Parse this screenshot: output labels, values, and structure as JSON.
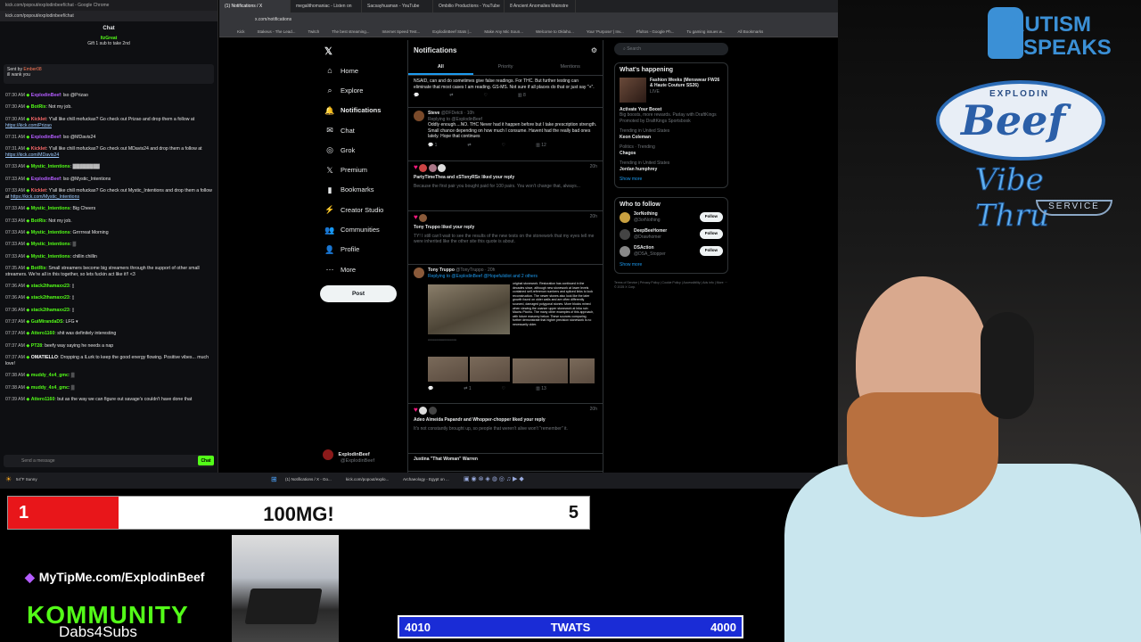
{
  "chat_window": {
    "title": "kick.com/popout/explodinbeef/chat - Google Chrome",
    "url": "kick.com/popout/explodinbeef/chat",
    "header": "Chat",
    "pinned_user": "ItzGreat",
    "pinned_text": "Gift 1 sub to take 2nd",
    "sent_by_label": "Sent by",
    "sent_by_user": "Ember08",
    "sent_text": "ill wank you",
    "input_placeholder": "Send a message",
    "chat_button": "Chat",
    "messages": [
      {
        "time": "07:30 AM",
        "user": "ExplodinBeef",
        "user_color": "#b45cff",
        "text": "lso @Prizao"
      },
      {
        "time": "07:30 AM",
        "user": "BotRix",
        "user_color": "#53fc18",
        "text": "Not my job."
      },
      {
        "time": "07:30 AM",
        "user": "Kicklet",
        "user_color": "#ff6b6b",
        "text": "Y'all like chill mofuckas? Go check out Prizao and drop them a follow at ",
        "link": "https://kick.com/Prizao"
      },
      {
        "time": "07:31 AM",
        "user": "ExplodinBeef",
        "user_color": "#b45cff",
        "text": "lso @MDavis24"
      },
      {
        "time": "07:31 AM",
        "user": "Kicklet",
        "user_color": "#ff6b6b",
        "text": "Y'all like chill mofuckas? Go check out MDavis24 and drop them a follow at ",
        "link": "https://kick.com/MDavis24"
      },
      {
        "time": "07:33 AM",
        "user": "Mystic_Intentions",
        "user_color": "#53fc18",
        "text": "▓▓▓▓▓▓▓▓"
      },
      {
        "time": "07:33 AM",
        "user": "ExplodinBeef",
        "user_color": "#b45cff",
        "text": "lso @Mystic_Intentions"
      },
      {
        "time": "07:33 AM",
        "user": "Kicklet",
        "user_color": "#ff6b6b",
        "text": "Y'all like chill mofuckas? Go check out Mystic_Intentions and drop them a follow at ",
        "link": "https://kick.com/Mystic_Intentions"
      },
      {
        "time": "07:33 AM",
        "user": "Mystic_Intentions",
        "user_color": "#53fc18",
        "text": "Big Cheers"
      },
      {
        "time": "07:33 AM",
        "user": "BotRix",
        "user_color": "#53fc18",
        "text": "Not my job."
      },
      {
        "time": "07:33 AM",
        "user": "Mystic_Intentions",
        "user_color": "#53fc18",
        "text": "Grrrrreat Morning"
      },
      {
        "time": "07:33 AM",
        "user": "Mystic_Intentions",
        "user_color": "#53fc18",
        "text": "▒"
      },
      {
        "time": "07:33 AM",
        "user": "Mystic_Intentions",
        "user_color": "#53fc18",
        "text": "chillin chillin"
      },
      {
        "time": "07:35 AM",
        "user": "BotRix",
        "user_color": "#53fc18",
        "text": "Small streamers become big streamers through the support of other small streamers. We're all in this together, so lets fuckin act like it!! <3"
      },
      {
        "time": "07:36 AM",
        "user": "stack2thamaxx23",
        "user_color": "#53fc18",
        "text": "▯"
      },
      {
        "time": "07:36 AM",
        "user": "stack2thamaxx23",
        "user_color": "#53fc18",
        "text": "▯"
      },
      {
        "time": "07:36 AM",
        "user": "stack2thamaxx23",
        "user_color": "#53fc18",
        "text": "▯"
      },
      {
        "time": "07:37 AM",
        "user": "GuiMirandaDS",
        "user_color": "#53fc18",
        "text": "LFG ▾"
      },
      {
        "time": "07:37 AM",
        "user": "Attero1160",
        "user_color": "#53fc18",
        "text": "shit was definitely interesting"
      },
      {
        "time": "07:37 AM",
        "user": "PT28",
        "user_color": "#53fc18",
        "text": "beefy way saying he needs a nap"
      },
      {
        "time": "07:37 AM",
        "user": "OMATIELLO",
        "user_color": "#ffffff",
        "text": "Dropping a lLurk to keep the good energy flowing. Positive vibes... much love!"
      },
      {
        "time": "07:38 AM",
        "user": "muddy_4x4_gmc",
        "user_color": "#53fc18",
        "text": "▒"
      },
      {
        "time": "07:38 AM",
        "user": "muddy_4x4_gmc",
        "user_color": "#53fc18",
        "text": "▒"
      },
      {
        "time": "07:39 AM",
        "user": "Attero1160",
        "user_color": "#53fc18",
        "text": "but as the way we can figure out savage's couldn't have done that"
      }
    ]
  },
  "browser": {
    "tabs": [
      "(1) Notifications / X",
      "megalithomaniac - Listen on",
      "Sacsayhuaman - YouTube",
      "Ombilio Productions - YouTube",
      "8 Ancient Anomalies Mainstre"
    ],
    "url": "x.com/notifications",
    "bookmarks": [
      "Kick",
      "Stakeus - The Lead...",
      "Twitch",
      "The best streaming...",
      "Internet Speed Test...",
      "ExplodinBeef Stats |...",
      "Make Any Mic Soun...",
      "Welcome to Oklaho...",
      "Your 'Purpose' | Inv...",
      "Ffultos - Google Ph...",
      "Tu gaming issues w...",
      "All Bookmarks"
    ]
  },
  "x_nav": {
    "items": [
      {
        "icon": "home-icon",
        "glyph": "⌂",
        "label": "Home"
      },
      {
        "icon": "search-icon",
        "glyph": "⌕",
        "label": "Explore"
      },
      {
        "icon": "bell-icon",
        "glyph": "🔔",
        "label": "Notifications"
      },
      {
        "icon": "chat-icon",
        "glyph": "✉",
        "label": "Chat"
      },
      {
        "icon": "grok-icon",
        "glyph": "◎",
        "label": "Grok"
      },
      {
        "icon": "x-icon",
        "glyph": "𝕏",
        "label": "Premium"
      },
      {
        "icon": "bookmark-icon",
        "glyph": "▮",
        "label": "Bookmarks"
      },
      {
        "icon": "bolt-icon",
        "glyph": "⚡",
        "label": "Creator Studio"
      },
      {
        "icon": "people-icon",
        "glyph": "👥",
        "label": "Communities"
      },
      {
        "icon": "person-icon",
        "glyph": "👤",
        "label": "Profile"
      },
      {
        "icon": "more-icon",
        "glyph": "⋯",
        "label": "More"
      }
    ],
    "post_button": "Post",
    "profile_name": "ExplodinBeef",
    "profile_handle": "@ExplodinBeef"
  },
  "notifications": {
    "title": "Notifications",
    "tabs": [
      "All",
      "Priority",
      "Mentions"
    ],
    "items": [
      {
        "text": "NSAID, can and do sometimes give false readings. For THC. But further testing can eliminate that most cases I am reading. GS-MS. Not sure if all places do that or just say \"+\".",
        "replies": "",
        "reposts": "",
        "likes": "",
        "views": "8"
      },
      {
        "name": "Steve",
        "handle": "@DFDetcti · 10h",
        "reply_to": "Replying to @ExplodinBeef",
        "text": "Oddly enough....NO. THC Never had it happen before but I take prescription strength. Small chance depending on how much I consume. Havent had the really bad ones lately. Hope that continues",
        "replies": "1",
        "likes": "",
        "views": "12"
      },
      {
        "like_text": "PartyTimeThea and xSTonyRSx liked your reply",
        "time": "20h",
        "quote": "Because the first pair you bought paid for 100 pairs. You won't change that, always..."
      },
      {
        "like_text": "Tony Truppo liked your reply",
        "time": "20h",
        "quote": "TY! I still can't wait to see the results of the new tests on the stonework that my eyes tell me were inherited like the other site this quote is about."
      },
      {
        "name": "Tony Truppo",
        "handle": "@TonyTruppo · 20h",
        "reply_to": "Replying to @ExplodinBeef @Hopefulidiot and 2 others",
        "side_text": "original stonework. Restoration has continued in the decades since, although new stonework at lower levels contained self-reference numbers and spliced links to look reconstruction. The newer stones also look like the later growth found on older walls and are often differently sourced, damaged polygonal stones. More blocks mined when viewing the coarser upper stonework at Inka ruin Machu Picchu. The many other examples of this approach, with future masonry below. These sources comparing further demonstrate that higher precision stonework is no necessarily older.",
        "replies": "1",
        "views": "13"
      },
      {
        "like_text": "Adeo Almeida Papandr and Whopper-chopper liked your reply",
        "time": "20h",
        "quote": "It's not constantly brought up, so people that weren't alive won't \"remember\" it."
      },
      {
        "like_text": "Justina \"That Woman\" Warren",
        "time": "",
        "quote": ""
      }
    ]
  },
  "right_col": {
    "search_placeholder": "Search",
    "happening_title": "What's happening",
    "trend1": "Fashion Weeks (Menswear FW26 & Haute Couture SS26)",
    "trend1_meta": "LIVE",
    "promo_title": "Activate Your Boost",
    "promo_text": "Big boosts, more rewards. Parlay with DraftKings",
    "promo_by": "Promoted by DraftKings Sportsbook",
    "trends": [
      {
        "meta": "Trending in United States",
        "name": "Keon Coleman"
      },
      {
        "meta": "Politics · Trending",
        "name": "Chagos"
      },
      {
        "meta": "Trending in United States",
        "name": "Jordan humphrey"
      }
    ],
    "show_more": "Show more",
    "who_title": "Who to follow",
    "follow": [
      {
        "name": "3orNothing",
        "handle": "@3orNothing"
      },
      {
        "name": "DeepBeeHomer",
        "handle": "@Drawhomer"
      },
      {
        "name": "DSAction",
        "handle": "@DSA_Stopper"
      }
    ],
    "follow_button": "Follow",
    "footer": "Terms of Service | Privacy Policy | Cookie Policy | Accessibility | Ads info | More ··· © 2025 X Corp."
  },
  "taskbar": {
    "weather": "54°F Sunny",
    "apps": [
      "(1) Notifications / X - Go...",
      "kick.com/popout/explo...",
      "Archaeology - Egypt on ..."
    ]
  },
  "overlay": {
    "score_left": "1",
    "score_title": "100MG!",
    "score_right": "5",
    "score_fill_fraction": 0.19,
    "tipme": "MyTipMe.com/ExplodinBeef",
    "kommunity": "KOMMUNITY",
    "dabs": "Dabs4Subs",
    "counter_left": "4010",
    "counter_title": "TWATS",
    "counter_right": "4000",
    "autism_line1": "AUTISM",
    "autism_line2": "SPEAKS",
    "beef_top": "EXPLODIN",
    "beef_main": "Beef",
    "beef_sub": "Vibe Thru",
    "beef_service": "SERVICE"
  },
  "colors": {
    "kick_green": "#53fc18",
    "x_blue": "#1d9bf0",
    "score_red": "#e8161a",
    "counter_blue": "#1a2cd6"
  }
}
